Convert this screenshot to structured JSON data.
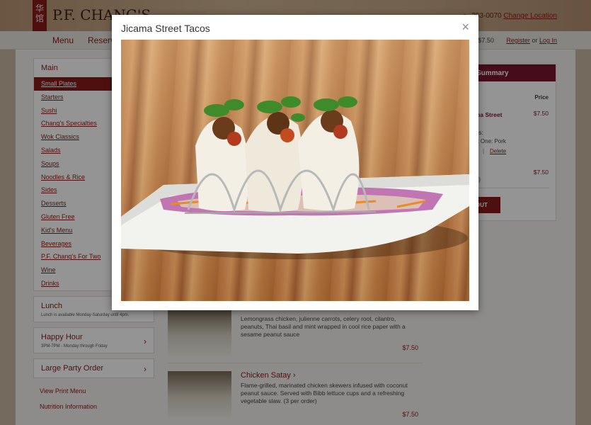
{
  "header": {
    "logo_glyph": "华\n馆",
    "logo_text": "P.F. CHANG'S",
    "phone": "393-0070",
    "change_location": "Change Location"
  },
  "nav": {
    "menu": "Menu",
    "reserve": "Reserv",
    "cart_status": "s | $7.50",
    "register": "Register",
    "or": "or",
    "login": "Log In"
  },
  "sidebar": {
    "main_title": "Main",
    "items": [
      "Small Plates",
      "Starters",
      "Sushi",
      "Chang's Specialties",
      "Wok Classics",
      "Salads",
      "Soups",
      "Noodles & Rice",
      "Sides",
      "Desserts",
      "Gluten Free",
      "Kid's Menu",
      "Beverages",
      "P.F. Chang's For Two",
      "Wine",
      "Drinks"
    ],
    "lunch": {
      "title": "Lunch",
      "sub": "Lunch is available Monday-Saturday until 4pm."
    },
    "happy_hour": {
      "title": "Happy Hour",
      "sub": "3PM-7PM - Monday through Friday"
    },
    "large_party": {
      "title": "Large Party Order"
    },
    "view_print_menu": "View Print Menu",
    "nutrition": "Nutrition Information"
  },
  "menu_items": [
    {
      "name": "",
      "desc": "Lemongrass chicken, julienne carrots, celery root, cilantro, peanuts, Thai basil and mint wrapped in cool rice paper with a sesame peanut sauce",
      "price": "$7.50"
    },
    {
      "name": "Chicken Satay ›",
      "desc": "Flame-grilled, marinated chicken skewers infused with coconut peanut sauce. Served with Bibb lettuce cups and a refreshing vegetable slaw. (3 per order)",
      "price": "$7.50"
    }
  ],
  "summary": {
    "title": "Summary",
    "col_price": "Price",
    "item_name": "ama Street\nos",
    "item_price": "$7.50",
    "options_label": "ions:",
    "option_value": "ect One: Pork",
    "delete": "Delete",
    "second_price": "$7.50",
    "apply": "ply)",
    "checkout": "OUT"
  },
  "modal": {
    "title": "Jicama Street Tacos",
    "close_glyph": "×",
    "image_alt": "Jicama Street Tacos photo"
  }
}
